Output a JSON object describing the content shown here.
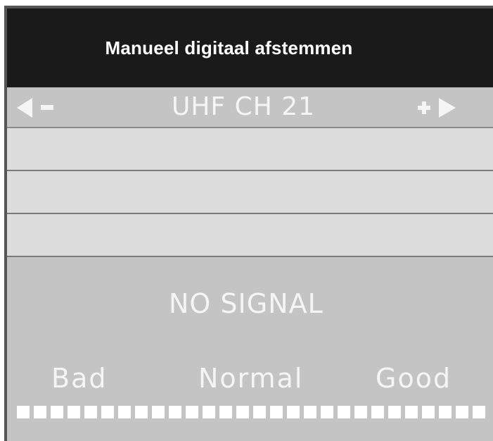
{
  "dialog": {
    "title": "Manueel digitaal afstemmen"
  },
  "channel": {
    "label": "UHF CH 21",
    "decrease_icon": "left-arrow-minus-icon",
    "increase_icon": "plus-right-arrow-icon"
  },
  "info_rows": [
    {
      "text": ""
    },
    {
      "text": ""
    },
    {
      "text": ""
    }
  ],
  "signal": {
    "status": "NO SIGNAL",
    "quality_labels": {
      "bad": "Bad",
      "normal": "Normal",
      "good": "Good"
    },
    "level": 0
  },
  "colors": {
    "title_bar": "#1a1a1a",
    "panel_gray": "#c4c4c4",
    "row_gray": "#dcdcdc",
    "text_light": "#f5f5f5"
  }
}
